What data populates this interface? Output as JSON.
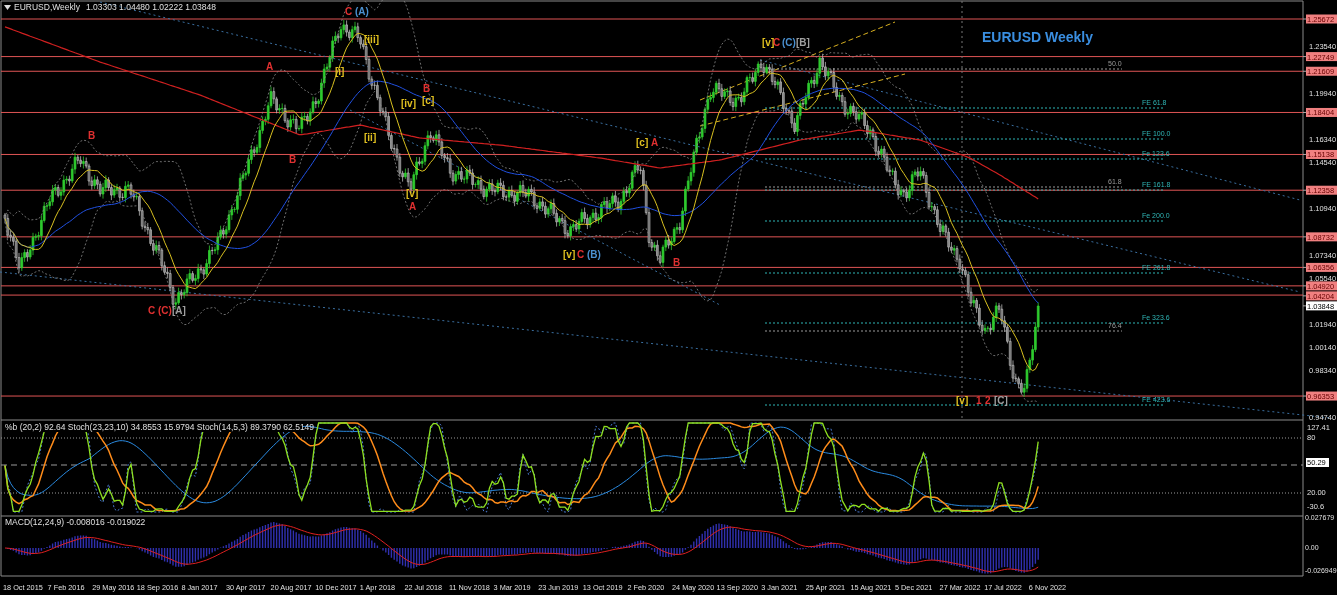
{
  "header": {
    "symbol": "EURUSD,Weekly",
    "ohlc": "1.03303 1.04480 1.02222 1.03848"
  },
  "title": "EURUSD Weekly",
  "price_axis": {
    "ticks": [
      "1.23540",
      "1.19940",
      "1.16340",
      "1.14540",
      "1.10940",
      "1.07340",
      "1.05540",
      "1.01940",
      "1.00140",
      "0.98340",
      "0.94740"
    ],
    "current_price": "1.03848"
  },
  "price_levels": [
    {
      "price": "1.25672"
    },
    {
      "price": "1.22749"
    },
    {
      "price": "1.21609"
    },
    {
      "price": "1.18404"
    },
    {
      "price": "1.15138"
    },
    {
      "price": "1.12358"
    },
    {
      "price": "1.08732"
    },
    {
      "price": "1.06356"
    },
    {
      "price": "1.04920"
    },
    {
      "price": "1.04204"
    },
    {
      "price": "0.96353"
    }
  ],
  "fibonacci_levels": [
    {
      "label": "50.0",
      "kind": "retracement"
    },
    {
      "label": "FE 61.8",
      "kind": "extension"
    },
    {
      "label": "FE 100.0",
      "kind": "extension"
    },
    {
      "label": "Fe 123.6",
      "kind": "extension"
    },
    {
      "label": "61.8",
      "kind": "retracement"
    },
    {
      "label": "FE 161.8",
      "kind": "extension"
    },
    {
      "label": "Fe 200.0",
      "kind": "extension"
    },
    {
      "label": "FE 261.8",
      "kind": "extension"
    },
    {
      "label": "Fe 323.6",
      "kind": "extension"
    },
    {
      "label": "76.4",
      "kind": "retracement"
    },
    {
      "label": "FE 423.6",
      "kind": "extension"
    }
  ],
  "wave_labels": [
    {
      "text": "B",
      "color": "#e03030"
    },
    {
      "text": "C",
      "color": "#e03030"
    },
    {
      "text": "(C)",
      "color": "#e03030"
    },
    {
      "text": "[A]",
      "color": "#a0a0a0"
    },
    {
      "text": "A",
      "color": "#e03030"
    },
    {
      "text": "B",
      "color": "#e03030"
    },
    {
      "text": "[i]",
      "color": "#e0c020"
    },
    {
      "text": "[iii]",
      "color": "#e0c020"
    },
    {
      "text": "C",
      "color": "#e03030"
    },
    {
      "text": "(A)",
      "color": "#4a90d0"
    },
    {
      "text": "[ii]",
      "color": "#e0c020"
    },
    {
      "text": "B",
      "color": "#e03030"
    },
    {
      "text": "[c]",
      "color": "#e0c020"
    },
    {
      "text": "[iv]",
      "color": "#e0c020"
    },
    {
      "text": "[v]",
      "color": "#e0c020"
    },
    {
      "text": "A",
      "color": "#e03030"
    },
    {
      "text": "[v]",
      "color": "#e0c020"
    },
    {
      "text": "C",
      "color": "#e03030"
    },
    {
      "text": "(B)",
      "color": "#4a90d0"
    },
    {
      "text": "[c]",
      "color": "#e0c020"
    },
    {
      "text": "A",
      "color": "#e03030"
    },
    {
      "text": "B",
      "color": "#e03030"
    },
    {
      "text": "[v]",
      "color": "#e0c020"
    },
    {
      "text": "C",
      "color": "#e03030"
    },
    {
      "text": "(C)",
      "color": "#4a90d0"
    },
    {
      "text": "[B]",
      "color": "#a0a0a0"
    },
    {
      "text": "[v]",
      "color": "#e0c020"
    },
    {
      "text": "1",
      "color": "#e03030"
    },
    {
      "text": "2",
      "color": "#e03030"
    },
    {
      "text": "[C]",
      "color": "#a0a0a0"
    }
  ],
  "oscillator_panel": {
    "legend": "%b (20,2) 92.64  Stoch(23,23,10) 34.8553 15.9794  Stoch(14,5,3) 89.3790 62.5149",
    "axis": [
      {
        "label": "127.41",
        "kind": "tick"
      },
      {
        "label": "80",
        "kind": "tick"
      },
      {
        "label": "50.29",
        "kind": "current"
      },
      {
        "label": "20.00",
        "kind": "tick"
      },
      {
        "label": "-30.6",
        "kind": "tick"
      }
    ]
  },
  "macd_panel": {
    "legend": "MACD(12,24,9) -0.008016 -0.019022",
    "axis": [
      "0.027679",
      "0.00",
      "-0.026949"
    ]
  },
  "time_axis": [
    "18 Oct 2015",
    "7 Feb 2016",
    "29 May 2016",
    "18 Sep 2016",
    "8 Jan 2017",
    "30 Apr 2017",
    "20 Aug 2017",
    "10 Dec 2017",
    "1 Apr 2018",
    "22 Jul 2018",
    "11 Nov 2018",
    "3 Mar 2019",
    "23 Jun 2019",
    "13 Oct 2019",
    "2 Feb 2020",
    "24 May 2020",
    "13 Sep 2020",
    "3 Jan 2021",
    "25 Apr 2021",
    "15 Aug 2021",
    "5 Dec 2021",
    "27 Mar 2022",
    "17 Jul 2022",
    "6 Nov 2022"
  ]
}
